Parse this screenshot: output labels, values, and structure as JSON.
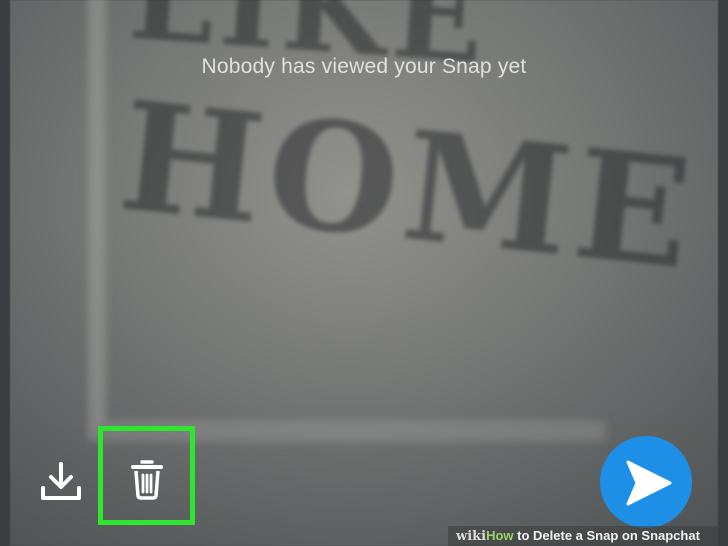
{
  "background": {
    "photo_text_top": "LIKE",
    "photo_text_bottom": "HOME"
  },
  "snap": {
    "status_message": "Nobody has viewed your Snap yet"
  },
  "controls": {
    "save_icon": "download-icon",
    "delete_icon": "trash-icon",
    "send_icon": "send-arrow-icon",
    "send_color": "#1d8fe6",
    "highlight_color": "#2ee62e"
  },
  "watermark": {
    "wiki": "wiki",
    "how": "How",
    "title": "to Delete a Snap on Snapchat"
  }
}
